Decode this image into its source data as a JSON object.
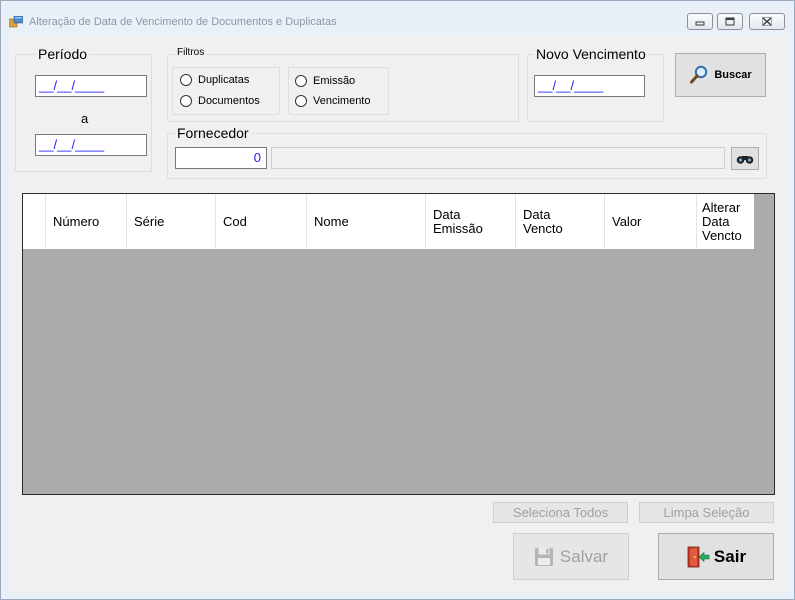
{
  "window": {
    "title": "Alteração de Data de Vencimento de Documentos e Duplicatas",
    "title_color": "#8a98a8"
  },
  "periodo": {
    "label": "Período",
    "start_value": "__/__/____",
    "separator": "a",
    "end_value": "__/__/____"
  },
  "filtros": {
    "label": "Filtros",
    "tipo_options": [
      {
        "label": "Duplicatas",
        "selected": false
      },
      {
        "label": "Documentos",
        "selected": false
      }
    ],
    "data_options": [
      {
        "label": "Emissão",
        "selected": false
      },
      {
        "label": "Vencimento",
        "selected": false
      }
    ]
  },
  "fornecedor": {
    "label": "Fornecedor",
    "code_value": "0",
    "name_value": ""
  },
  "novo_vencimento": {
    "label": "Novo Vencimento",
    "value": "__/__/____"
  },
  "buttons": {
    "buscar": "Buscar",
    "seleciona_todos": "Seleciona Todos",
    "limpa_selecao": "Limpa Seleção",
    "salvar": "Salvar",
    "sair": "Sair"
  },
  "grid": {
    "columns": [
      "Número",
      "Série",
      "Cod",
      "Nome",
      "Data\nEmissão",
      "Data\nVencto",
      "Valor",
      "Alterar\nData\nVencto"
    ],
    "rows": []
  },
  "colors": {
    "date_text": "#1a1aff",
    "grid_background": "#ababab",
    "sair_icon": "#c0392b",
    "sair_arrow": "#27ae60"
  }
}
